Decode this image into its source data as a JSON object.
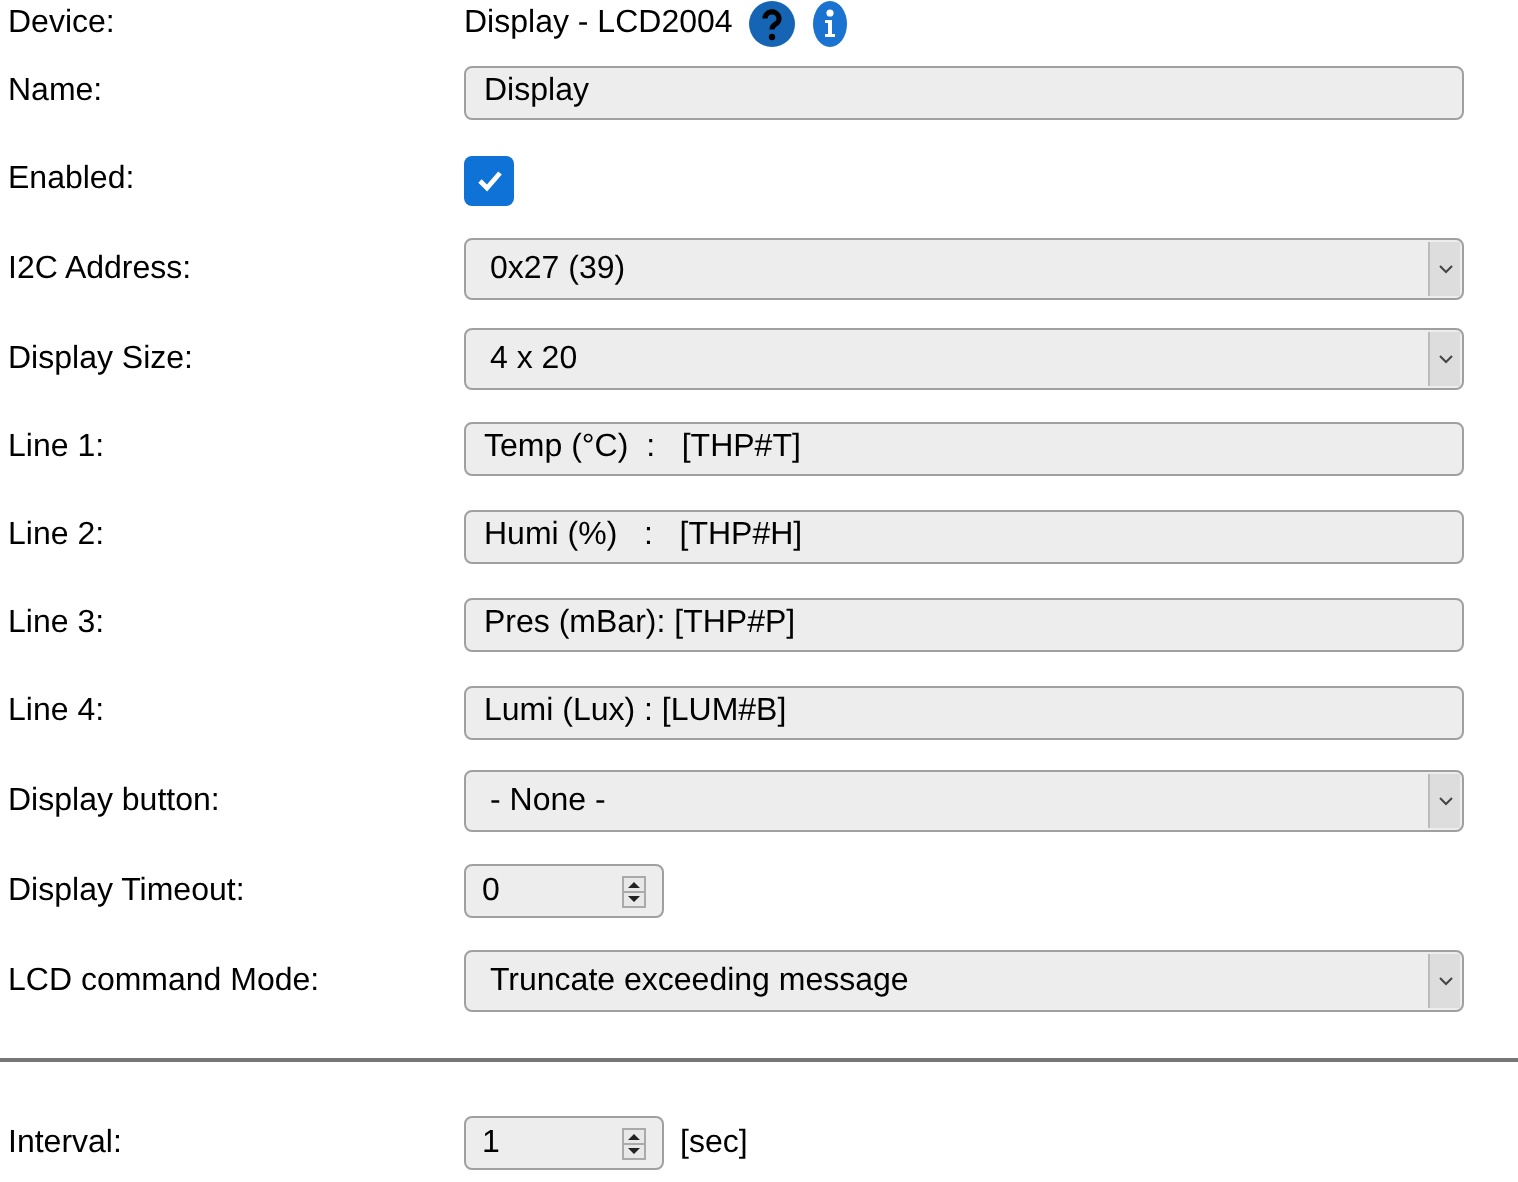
{
  "rows": [
    {
      "kind": "text",
      "label": "Device:",
      "value": "Display - LCD2004"
    },
    {
      "kind": "field",
      "label": "Name:",
      "value": "Display"
    },
    {
      "kind": "checkbox",
      "label": "Enabled:",
      "checked": true
    },
    {
      "kind": "select",
      "label": "I2C Address:",
      "value": "0x27 (39)"
    },
    {
      "kind": "select",
      "label": "Display Size:",
      "value": "4 x 20"
    },
    {
      "kind": "field",
      "label": "Line 1:",
      "value": "Temp (°C)  :   [THP#T]"
    },
    {
      "kind": "field",
      "label": "Line 2:",
      "value": "Humi (%)   :   [THP#H]"
    },
    {
      "kind": "field",
      "label": "Line 3:",
      "value": "Pres (mBar): [THP#P]"
    },
    {
      "kind": "field",
      "label": "Line 4:",
      "value": "Lumi (Lux) : [LUM#B]"
    },
    {
      "kind": "select",
      "label": "Display button:",
      "value": "- None -"
    },
    {
      "kind": "number",
      "label": "Display Timeout:",
      "value": "0"
    },
    {
      "kind": "select",
      "label": "LCD command Mode:",
      "value": "Truncate exceeding message"
    },
    {
      "kind": "divider"
    },
    {
      "kind": "number",
      "label": "Interval:",
      "value": "1",
      "unit": "[sec]"
    }
  ]
}
